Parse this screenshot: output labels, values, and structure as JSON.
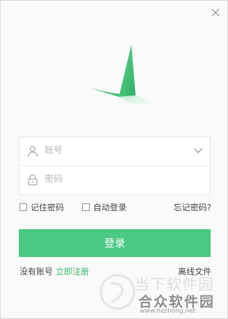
{
  "login": {
    "account_placeholder": "账号",
    "password_placeholder": "密码",
    "remember_password": "记住密码",
    "auto_login": "自动登录",
    "forgot_password": "忘记密码?",
    "login_button": "登录",
    "no_account": "没有账号",
    "register_now": "立即注册",
    "offline_files": "离线文件"
  },
  "watermark": {
    "line1": "当下软件园",
    "line2": "合众软件园",
    "url": "www.hezhong.net"
  },
  "colors": {
    "accent": "#4cc885",
    "link": "#36b36d",
    "logo_dark": "#2fae62",
    "logo_light": "#7be0a2"
  },
  "icons": {
    "close": "close-icon",
    "user": "user-icon",
    "lock": "lock-icon",
    "dropdown": "chevron-down-icon",
    "logo": "app-logo"
  }
}
